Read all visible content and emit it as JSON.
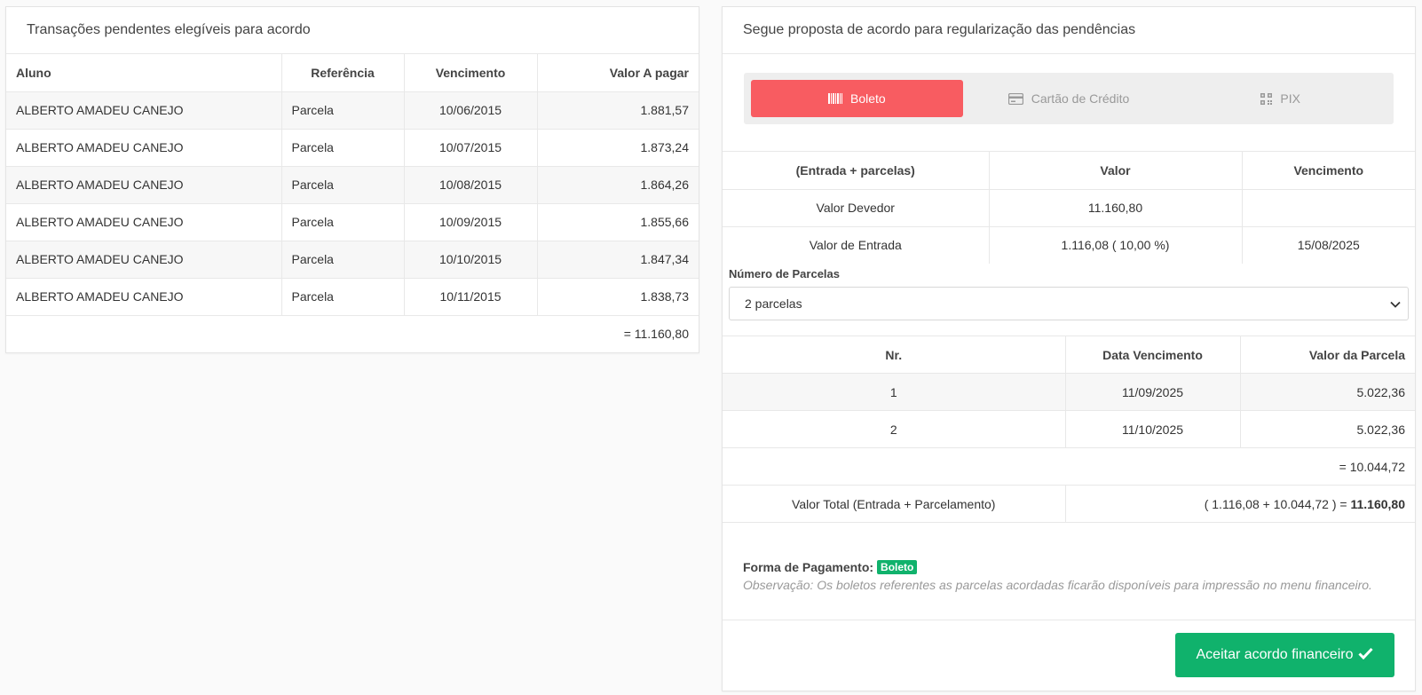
{
  "left": {
    "title": "Transações pendentes elegíveis para acordo",
    "columns": [
      "Aluno",
      "Referência",
      "Vencimento",
      "Valor A pagar"
    ],
    "rows": [
      [
        "ALBERTO AMADEU CANEJO",
        "Parcela",
        "10/06/2015",
        "1.881,57"
      ],
      [
        "ALBERTO AMADEU CANEJO",
        "Parcela",
        "10/07/2015",
        "1.873,24"
      ],
      [
        "ALBERTO AMADEU CANEJO",
        "Parcela",
        "10/08/2015",
        "1.864,26"
      ],
      [
        "ALBERTO AMADEU CANEJO",
        "Parcela",
        "10/09/2015",
        "1.855,66"
      ],
      [
        "ALBERTO AMADEU CANEJO",
        "Parcela",
        "10/10/2015",
        "1.847,34"
      ],
      [
        "ALBERTO AMADEU CANEJO",
        "Parcela",
        "10/11/2015",
        "1.838,73"
      ]
    ],
    "total": "= 11.160,80"
  },
  "right": {
    "title": "Segue proposta de acordo para regularização das pendências",
    "tabs": [
      {
        "label": "Boleto",
        "icon": "barcode-icon",
        "active": true
      },
      {
        "label": "Cartão de Crédito",
        "icon": "credit-card-icon",
        "active": false
      },
      {
        "label": "PIX",
        "icon": "qrcode-icon",
        "active": false
      }
    ],
    "summary": {
      "columns": [
        "(Entrada + parcelas)",
        "Valor",
        "Vencimento"
      ],
      "rows": [
        [
          "Valor Devedor",
          "11.160,80",
          ""
        ],
        [
          "Valor de Entrada",
          "1.116,08 ( 10,00 %)",
          "15/08/2025"
        ]
      ]
    },
    "installments_label": "Número de Parcelas",
    "installments_selected": "2 parcelas",
    "installments": {
      "columns": [
        "Nr.",
        "Data Vencimento",
        "Valor da Parcela"
      ],
      "rows": [
        [
          "1",
          "11/09/2025",
          "5.022,36"
        ],
        [
          "2",
          "11/10/2025",
          "5.022,36"
        ]
      ],
      "subtotal": "= 10.044,72",
      "total_label": "Valor Total (Entrada + Parcelamento)",
      "total_expr": "( 1.116,08 + 10.044,72 ) = ",
      "total_value": "11.160,80"
    },
    "payment_label": "Forma de Pagamento:",
    "payment_badge": "Boleto",
    "observation": "Observação: Os boletos referentes as parcelas acordadas ficarão disponíveis para impressão no menu financeiro.",
    "accept_button": "Aceitar acordo financeiro"
  },
  "colors": {
    "active_tab": "#f85c61",
    "accept": "#10b26c"
  }
}
